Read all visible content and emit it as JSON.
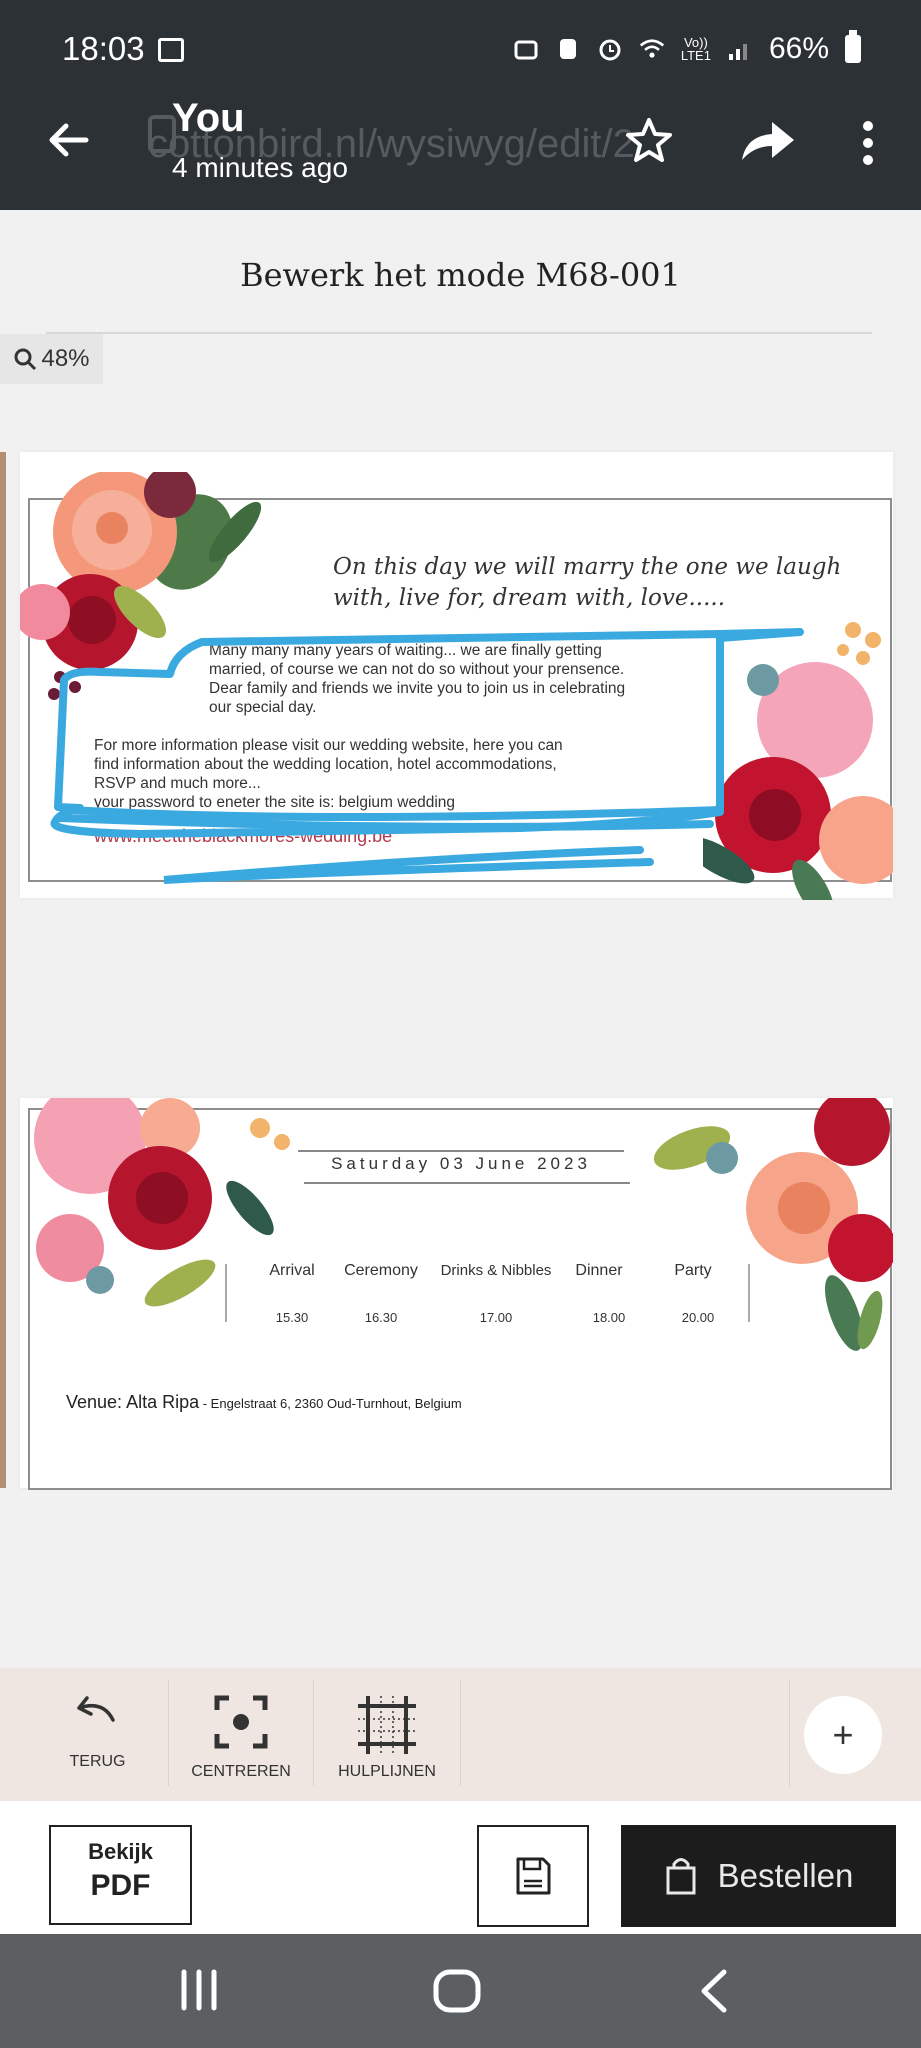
{
  "status_bar": {
    "time": "18:03",
    "battery": "66%",
    "volte": "Vo))\nLTE1"
  },
  "app_bar": {
    "title": "You",
    "subtitle": "4 minutes ago",
    "url_behind": "cottonbird.nl/wysiwyg/edit/2"
  },
  "editor": {
    "title": "Bewerk het mode M68-001",
    "zoom": "48%"
  },
  "card_front": {
    "script_line": "On this day we will marry the one we laugh with, live for, dream with, love.....",
    "paragraph1": [
      "Many many many years of waiting... we are finally getting",
      "married, of course we can not do so without your prensence.",
      "Dear family and friends we invite you to join us in celebrating",
      "our special day."
    ],
    "paragraph2": [
      "For more information please visit our wedding website, here you can",
      "find information about the wedding location, hotel accommodations,",
      "RSVP and much more...",
      "your password to eneter the site is: belgium wedding"
    ],
    "website": "www.meettheblackmores-wedding.be"
  },
  "card_back": {
    "date": "Saturday  03 June 2023",
    "schedule": [
      {
        "label": "Arrival",
        "time": "15.30"
      },
      {
        "label": "Ceremony",
        "time": "16.30"
      },
      {
        "label": "Drinks & Nibbles",
        "time": "17.00"
      },
      {
        "label": "Dinner",
        "time": "18.00"
      },
      {
        "label": "Party",
        "time": "20.00"
      }
    ],
    "venue_label": "Venue: Alta Ripa",
    "venue_address": " - Engelstraat 6, 2360 Oud-Turnhout, Belgium"
  },
  "toolbar": {
    "undo": "TERUG",
    "center": "CENTREREN",
    "guides": "HULPLIJNEN",
    "add": "+"
  },
  "actions": {
    "pdf_line1": "Bekijk",
    "pdf_line2": "PDF",
    "order": "Bestellen"
  },
  "colors": {
    "app_bar": "#2c3136",
    "scribble": "#3aa9e0",
    "order_button": "#1c1c1c",
    "toolbar_bg": "#efe6e1",
    "website_text": "#b23a4e"
  }
}
